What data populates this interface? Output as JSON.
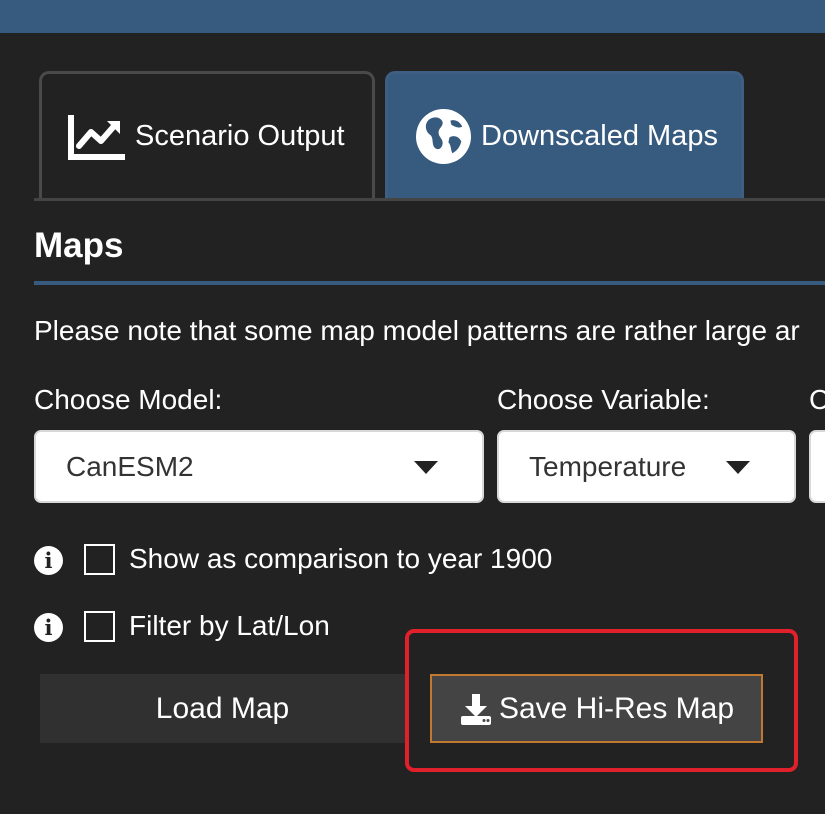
{
  "tabs": [
    {
      "label": "Scenario Output",
      "icon": "chart-line-icon"
    },
    {
      "label": "Downscaled Maps",
      "icon": "globe-icon"
    }
  ],
  "section": {
    "title": "Maps"
  },
  "note": "Please note that some map model patterns are rather large ar",
  "fields": [
    {
      "label": "Choose Model:",
      "value": "CanESM2"
    },
    {
      "label": "Choose Variable:",
      "value": "Temperature"
    },
    {
      "label": "C"
    }
  ],
  "options": {
    "comparison_label": "Show as comparison to year 1900",
    "filter_label": "Filter by Lat/Lon"
  },
  "buttons": {
    "load_label": "Load Map",
    "save_label": "Save Hi-Res Map"
  },
  "colors": {
    "accent": "#375a7f",
    "background": "#222222",
    "highlight": "#e0202a",
    "save_border": "#c0792f"
  }
}
